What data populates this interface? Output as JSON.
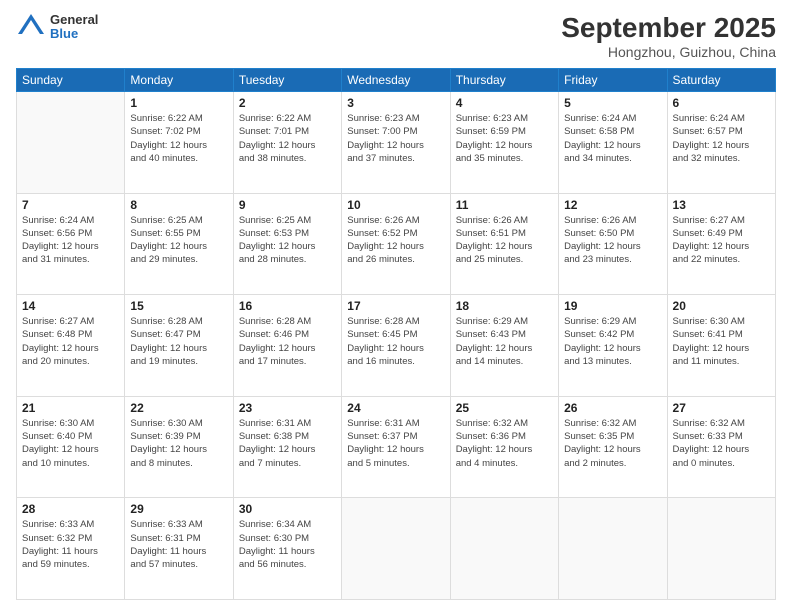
{
  "logo": {
    "general": "General",
    "blue": "Blue"
  },
  "header": {
    "month": "September 2025",
    "location": "Hongzhou, Guizhou, China"
  },
  "weekdays": [
    "Sunday",
    "Monday",
    "Tuesday",
    "Wednesday",
    "Thursday",
    "Friday",
    "Saturday"
  ],
  "weeks": [
    [
      {
        "day": "",
        "info": ""
      },
      {
        "day": "1",
        "info": "Sunrise: 6:22 AM\nSunset: 7:02 PM\nDaylight: 12 hours\nand 40 minutes."
      },
      {
        "day": "2",
        "info": "Sunrise: 6:22 AM\nSunset: 7:01 PM\nDaylight: 12 hours\nand 38 minutes."
      },
      {
        "day": "3",
        "info": "Sunrise: 6:23 AM\nSunset: 7:00 PM\nDaylight: 12 hours\nand 37 minutes."
      },
      {
        "day": "4",
        "info": "Sunrise: 6:23 AM\nSunset: 6:59 PM\nDaylight: 12 hours\nand 35 minutes."
      },
      {
        "day": "5",
        "info": "Sunrise: 6:24 AM\nSunset: 6:58 PM\nDaylight: 12 hours\nand 34 minutes."
      },
      {
        "day": "6",
        "info": "Sunrise: 6:24 AM\nSunset: 6:57 PM\nDaylight: 12 hours\nand 32 minutes."
      }
    ],
    [
      {
        "day": "7",
        "info": "Sunrise: 6:24 AM\nSunset: 6:56 PM\nDaylight: 12 hours\nand 31 minutes."
      },
      {
        "day": "8",
        "info": "Sunrise: 6:25 AM\nSunset: 6:55 PM\nDaylight: 12 hours\nand 29 minutes."
      },
      {
        "day": "9",
        "info": "Sunrise: 6:25 AM\nSunset: 6:53 PM\nDaylight: 12 hours\nand 28 minutes."
      },
      {
        "day": "10",
        "info": "Sunrise: 6:26 AM\nSunset: 6:52 PM\nDaylight: 12 hours\nand 26 minutes."
      },
      {
        "day": "11",
        "info": "Sunrise: 6:26 AM\nSunset: 6:51 PM\nDaylight: 12 hours\nand 25 minutes."
      },
      {
        "day": "12",
        "info": "Sunrise: 6:26 AM\nSunset: 6:50 PM\nDaylight: 12 hours\nand 23 minutes."
      },
      {
        "day": "13",
        "info": "Sunrise: 6:27 AM\nSunset: 6:49 PM\nDaylight: 12 hours\nand 22 minutes."
      }
    ],
    [
      {
        "day": "14",
        "info": "Sunrise: 6:27 AM\nSunset: 6:48 PM\nDaylight: 12 hours\nand 20 minutes."
      },
      {
        "day": "15",
        "info": "Sunrise: 6:28 AM\nSunset: 6:47 PM\nDaylight: 12 hours\nand 19 minutes."
      },
      {
        "day": "16",
        "info": "Sunrise: 6:28 AM\nSunset: 6:46 PM\nDaylight: 12 hours\nand 17 minutes."
      },
      {
        "day": "17",
        "info": "Sunrise: 6:28 AM\nSunset: 6:45 PM\nDaylight: 12 hours\nand 16 minutes."
      },
      {
        "day": "18",
        "info": "Sunrise: 6:29 AM\nSunset: 6:43 PM\nDaylight: 12 hours\nand 14 minutes."
      },
      {
        "day": "19",
        "info": "Sunrise: 6:29 AM\nSunset: 6:42 PM\nDaylight: 12 hours\nand 13 minutes."
      },
      {
        "day": "20",
        "info": "Sunrise: 6:30 AM\nSunset: 6:41 PM\nDaylight: 12 hours\nand 11 minutes."
      }
    ],
    [
      {
        "day": "21",
        "info": "Sunrise: 6:30 AM\nSunset: 6:40 PM\nDaylight: 12 hours\nand 10 minutes."
      },
      {
        "day": "22",
        "info": "Sunrise: 6:30 AM\nSunset: 6:39 PM\nDaylight: 12 hours\nand 8 minutes."
      },
      {
        "day": "23",
        "info": "Sunrise: 6:31 AM\nSunset: 6:38 PM\nDaylight: 12 hours\nand 7 minutes."
      },
      {
        "day": "24",
        "info": "Sunrise: 6:31 AM\nSunset: 6:37 PM\nDaylight: 12 hours\nand 5 minutes."
      },
      {
        "day": "25",
        "info": "Sunrise: 6:32 AM\nSunset: 6:36 PM\nDaylight: 12 hours\nand 4 minutes."
      },
      {
        "day": "26",
        "info": "Sunrise: 6:32 AM\nSunset: 6:35 PM\nDaylight: 12 hours\nand 2 minutes."
      },
      {
        "day": "27",
        "info": "Sunrise: 6:32 AM\nSunset: 6:33 PM\nDaylight: 12 hours\nand 0 minutes."
      }
    ],
    [
      {
        "day": "28",
        "info": "Sunrise: 6:33 AM\nSunset: 6:32 PM\nDaylight: 11 hours\nand 59 minutes."
      },
      {
        "day": "29",
        "info": "Sunrise: 6:33 AM\nSunset: 6:31 PM\nDaylight: 11 hours\nand 57 minutes."
      },
      {
        "day": "30",
        "info": "Sunrise: 6:34 AM\nSunset: 6:30 PM\nDaylight: 11 hours\nand 56 minutes."
      },
      {
        "day": "",
        "info": ""
      },
      {
        "day": "",
        "info": ""
      },
      {
        "day": "",
        "info": ""
      },
      {
        "day": "",
        "info": ""
      }
    ]
  ]
}
